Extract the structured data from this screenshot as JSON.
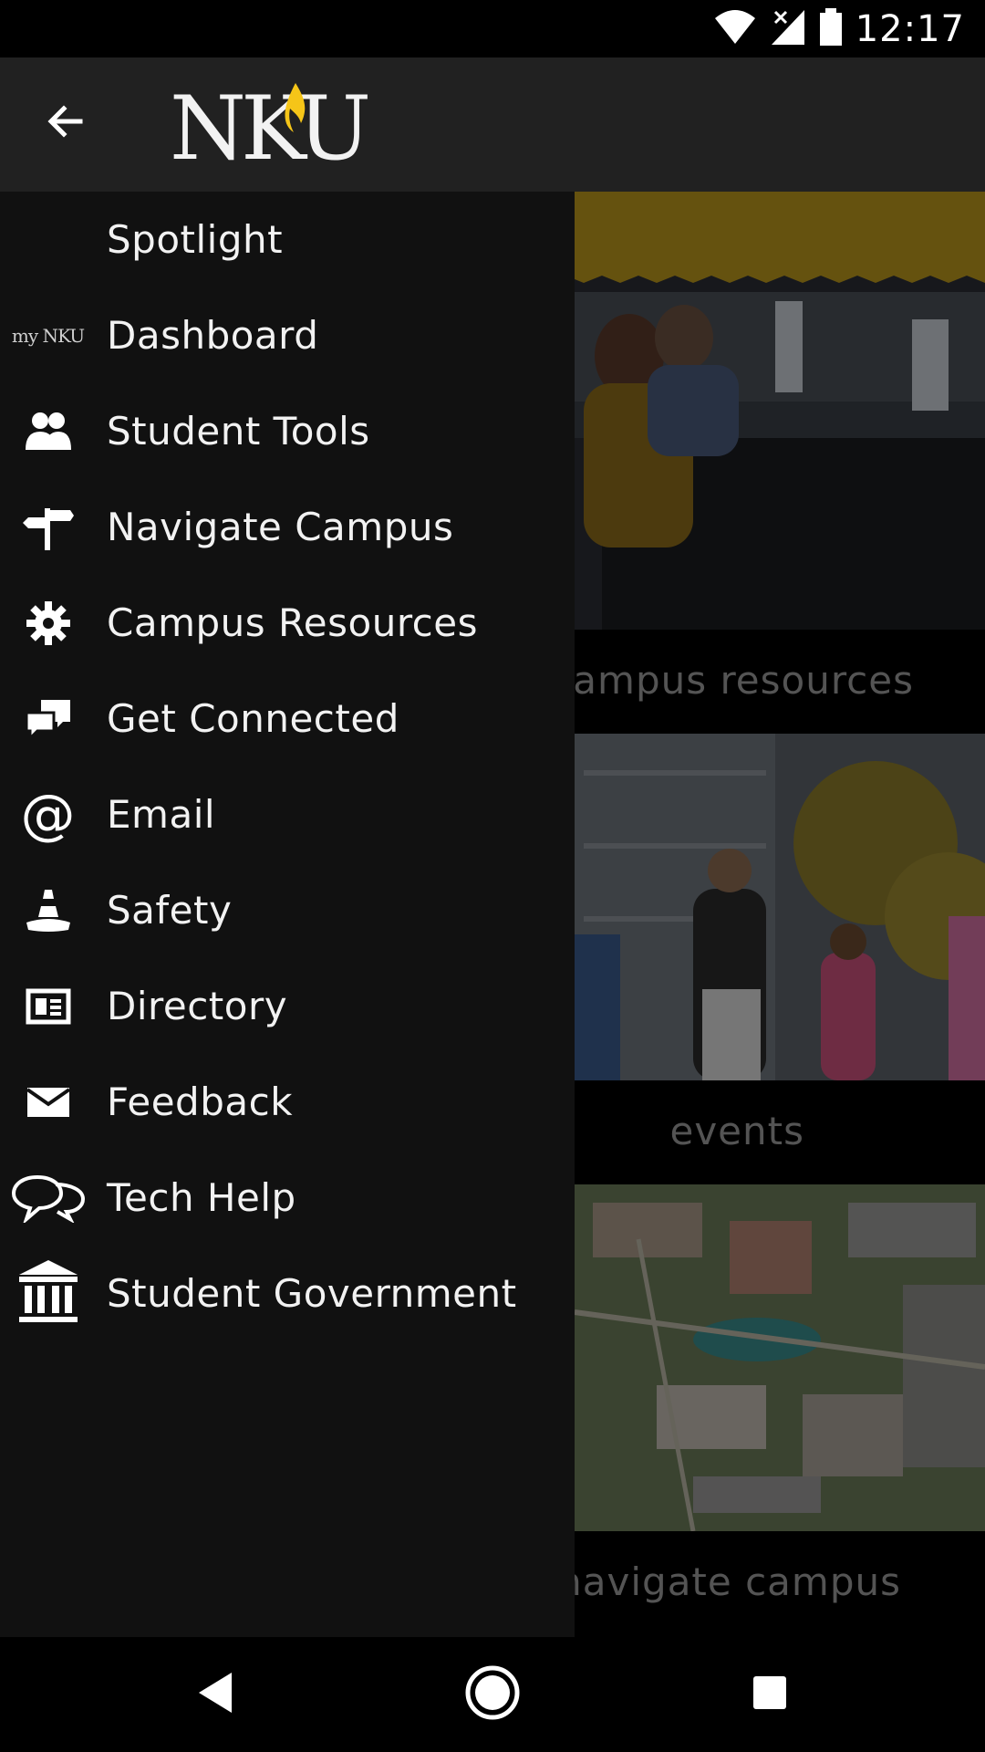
{
  "status_bar": {
    "time": "12:17",
    "icons": [
      "wifi-icon",
      "signal-off-icon",
      "battery-icon"
    ]
  },
  "app_bar": {
    "logo_text": "NKU",
    "back_icon": "arrow-back-icon"
  },
  "drawer": {
    "items": [
      {
        "label": "Spotlight",
        "icon": "none"
      },
      {
        "label": "Dashboard",
        "icon": "mynku-icon",
        "icon_text": "my NKU"
      },
      {
        "label": "Student Tools",
        "icon": "people-icon"
      },
      {
        "label": "Navigate Campus",
        "icon": "signpost-icon"
      },
      {
        "label": "Campus Resources",
        "icon": "gear-icon"
      },
      {
        "label": "Get Connected",
        "icon": "chat-bubbles-icon"
      },
      {
        "label": "Email",
        "icon": "at-sign-icon"
      },
      {
        "label": "Safety",
        "icon": "traffic-cone-icon"
      },
      {
        "label": "Directory",
        "icon": "id-card-icon"
      },
      {
        "label": "Feedback",
        "icon": "envelope-icon"
      },
      {
        "label": "Tech Help",
        "icon": "speech-bubbles-outline-icon"
      },
      {
        "label": "Student Government",
        "icon": "government-building-icon"
      }
    ]
  },
  "content": {
    "cards": [
      {
        "label": "campus resources"
      },
      {
        "label": "events"
      },
      {
        "label": "navigate campus"
      }
    ]
  },
  "colors": {
    "accent_gold": "#c9a227",
    "drawer_bg": "#111111",
    "appbar_bg": "#212121"
  },
  "nav_bar": {
    "icons": [
      "back-triangle-icon",
      "home-circle-icon",
      "recents-square-icon"
    ]
  }
}
